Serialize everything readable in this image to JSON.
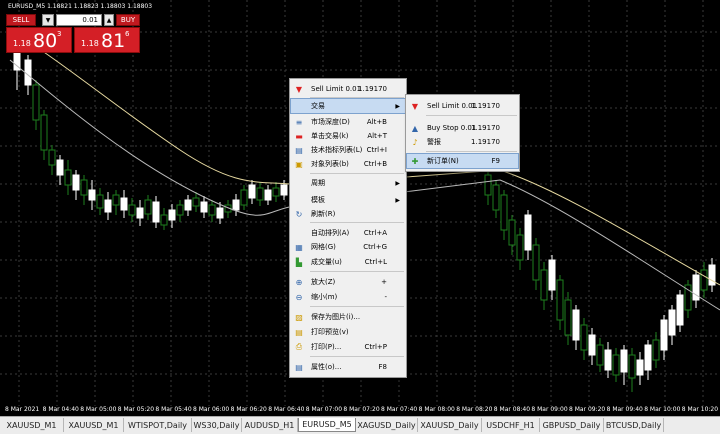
{
  "chart": {
    "title": "EURUSD_M5  1.18821 1.18823 1.18803 1.18803",
    "colors": {
      "bull": "#ffffff",
      "bear": "#1e7f1e",
      "ma_fast": "#e6d9a0",
      "ma_slow": "#b9b9b9",
      "grid": "#3a3a3a"
    }
  },
  "trade_panel": {
    "sell_label": "SELL",
    "buy_label": "BUY",
    "lot": "0.01",
    "sell_small": "1.18",
    "sell_big": "80",
    "sell_sup": "3",
    "buy_small": "1.18",
    "buy_big": "81",
    "buy_sup": "6"
  },
  "time_axis": [
    "8 Mar 2021",
    "8 Mar 04:40",
    "8 Mar 05:00",
    "8 Mar 05:20",
    "8 Mar 05:40",
    "8 Mar 06:00",
    "8 Mar 06:20",
    "8 Mar 06:40",
    "8 Mar 07:00",
    "8 Mar 07:20",
    "8 Mar 07:40",
    "8 Mar 08:00",
    "8 Mar 08:20",
    "8 Mar 08:40",
    "8 Mar 09:00",
    "8 Mar 09:20",
    "8 Mar 09:40",
    "8 Mar 10:00",
    "8 Mar 10:20"
  ],
  "tabs": [
    "XAUUSD_M1",
    "XAUUSD_M1",
    "WTISPOT,Daily",
    "WS30,Daily",
    "AUDUSD_H1",
    "EURUSD_M5",
    "XAGUSD_Daily",
    "XAUUSD_Daily",
    "USDCHF_H1",
    "GBPUSD_Daily",
    "BTCUSD,Daily"
  ],
  "active_tab": 5,
  "context_menu": {
    "items": [
      {
        "label": "Sell Limit 0.01",
        "shortcut": "1.19170",
        "icon": "sell-limit-icon"
      },
      {
        "label": "交易",
        "shortcut": "",
        "icon": "",
        "submenu": true,
        "highlight": true
      },
      {
        "label": "市场深度(D)",
        "shortcut": "Alt+B",
        "icon": "market-depth-icon"
      },
      {
        "label": "单击交易(k)",
        "shortcut": "Alt+T",
        "icon": "one-click-trading-icon"
      },
      {
        "label": "技术指标列表(L)",
        "shortcut": "Ctrl+I",
        "icon": "indicators-list-icon"
      },
      {
        "label": "对象列表(b)",
        "shortcut": "Ctrl+B",
        "icon": "objects-list-icon"
      },
      {
        "label": "周期",
        "shortcut": "",
        "icon": "",
        "submenu": true
      },
      {
        "label": "模板",
        "shortcut": "",
        "icon": "",
        "submenu": true
      },
      {
        "label": "刷新(R)",
        "shortcut": "",
        "icon": "refresh-icon"
      },
      {
        "label": "自动排列(A)",
        "shortcut": "Ctrl+A",
        "icon": ""
      },
      {
        "label": "网格(G)",
        "shortcut": "Ctrl+G",
        "icon": "grid-icon"
      },
      {
        "label": "成交量(u)",
        "shortcut": "Ctrl+L",
        "icon": "volumes-icon"
      },
      {
        "label": "放大(Z)",
        "shortcut": "+",
        "icon": "zoom-in-icon"
      },
      {
        "label": "缩小(m)",
        "shortcut": "-",
        "icon": "zoom-out-icon"
      },
      {
        "label": "保存为图片(i)...",
        "shortcut": "",
        "icon": "save-picture-icon"
      },
      {
        "label": "打印预览(v)",
        "shortcut": "",
        "icon": "print-preview-icon"
      },
      {
        "label": "打印(P)...",
        "shortcut": "Ctrl+P",
        "icon": "print-icon"
      },
      {
        "label": "属性(o)...",
        "shortcut": "F8",
        "icon": "properties-icon"
      }
    ]
  },
  "submenu": {
    "items": [
      {
        "label": "Sell Limit 0.01",
        "shortcut": "1.19170",
        "icon": "sell-limit-icon"
      },
      {
        "label": "Buy Stop 0.01",
        "shortcut": "1.19170",
        "icon": "buy-stop-icon"
      },
      {
        "label": "警报",
        "shortcut": "1.19170",
        "icon": "alert-bell-icon"
      },
      {
        "label": "新订单(N)",
        "shortcut": "F9",
        "icon": "new-order-icon",
        "highlight": true
      }
    ]
  }
}
